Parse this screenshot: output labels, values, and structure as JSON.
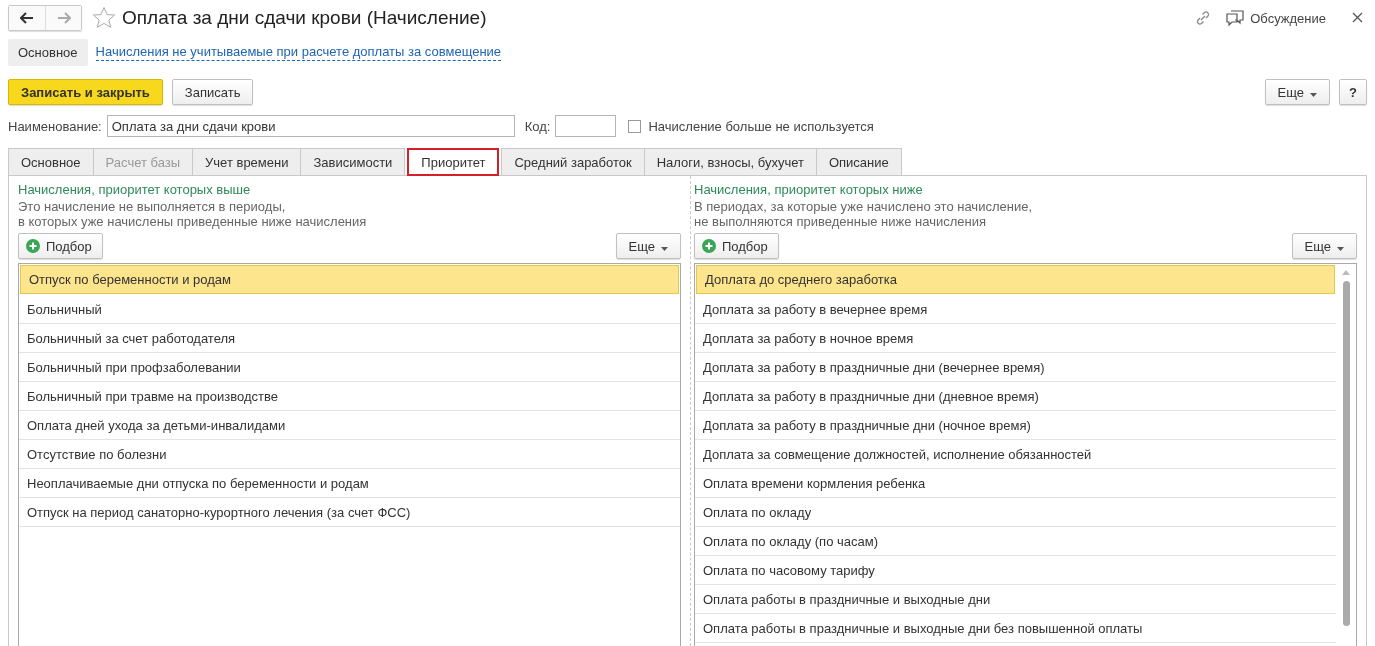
{
  "window": {
    "title": "Оплата за дни сдачи крови (Начисление)",
    "favorite": false,
    "discussion": "Обсуждение"
  },
  "sections": [
    {
      "label": "Основное",
      "selected": true
    },
    {
      "label": "Начисления не учитываемые при расчете доплаты за совмещение",
      "selected": false
    }
  ],
  "toolbar": {
    "primary": "Записать и закрыть",
    "save": "Записать",
    "more": "Еще",
    "help": "?"
  },
  "form": {
    "name_label": "Наименование:",
    "name_value": "Оплата за дни сдачи крови",
    "code_label": "Код:",
    "unused_label": "Начисление больше не используется",
    "unused_checked": false
  },
  "tabs": [
    {
      "label": "Основное",
      "selected": false,
      "disabled": false
    },
    {
      "label": "Расчет базы",
      "selected": false,
      "disabled": true
    },
    {
      "label": "Учет времени",
      "selected": false,
      "disabled": false
    },
    {
      "label": "Зависимости",
      "selected": false,
      "disabled": false
    },
    {
      "label": "Приоритет",
      "selected": true,
      "disabled": false
    },
    {
      "label": "Средний заработок",
      "selected": false,
      "disabled": false
    },
    {
      "label": "Налоги, взносы, бухучет",
      "selected": false,
      "disabled": false
    },
    {
      "label": "Описание",
      "selected": false,
      "disabled": false
    }
  ],
  "panels": [
    {
      "title": "Начисления, приоритет которых выше",
      "hint": [
        "Это начисление не выполняется в периоды,",
        "в которых уже начислены приведенные ниже начисления"
      ],
      "pick": "Подбор",
      "more": "Еще",
      "scrollbar": false,
      "rows": [
        {
          "text": "Отпуск по беременности и родам",
          "selected": true
        },
        {
          "text": "Больничный",
          "selected": false
        },
        {
          "text": "Больничный за счет работодателя",
          "selected": false
        },
        {
          "text": "Больничный при профзаболевании",
          "selected": false
        },
        {
          "text": "Больничный при травме на производстве",
          "selected": false
        },
        {
          "text": "Оплата дней ухода за детьми-инвалидами",
          "selected": false
        },
        {
          "text": "Отсутствие по болезни",
          "selected": false
        },
        {
          "text": "Неоплачиваемые дни отпуска по беременности и родам",
          "selected": false
        },
        {
          "text": "Отпуск на период санаторно-курортного лечения (за счет ФСС)",
          "selected": false
        }
      ]
    },
    {
      "title": "Начисления, приоритет которых ниже",
      "hint": [
        "В периодах, за которые уже начислено это начисление,",
        "не выполняются приведенные ниже начисления"
      ],
      "pick": "Подбор",
      "more": "Еще",
      "scrollbar": true,
      "rows": [
        {
          "text": "Доплата до среднего заработка",
          "selected": true
        },
        {
          "text": "Доплата за работу в вечернее время",
          "selected": false
        },
        {
          "text": "Доплата за работу в ночное время",
          "selected": false
        },
        {
          "text": "Доплата за работу в праздничные дни (вечернее время)",
          "selected": false
        },
        {
          "text": "Доплата за работу в праздничные дни (дневное время)",
          "selected": false
        },
        {
          "text": "Доплата за работу в праздничные дни (ночное время)",
          "selected": false
        },
        {
          "text": "Доплата за совмещение должностей, исполнение обязанностей",
          "selected": false
        },
        {
          "text": "Оплата времени кормления ребенка",
          "selected": false
        },
        {
          "text": "Оплата по окладу",
          "selected": false
        },
        {
          "text": "Оплата по окладу (по часам)",
          "selected": false
        },
        {
          "text": "Оплата по часовому тарифу",
          "selected": false
        },
        {
          "text": "Оплата работы в праздничные и выходные дни",
          "selected": false
        },
        {
          "text": "Оплата работы в праздничные и выходные дни без повышенной оплаты",
          "selected": false
        }
      ]
    }
  ]
}
